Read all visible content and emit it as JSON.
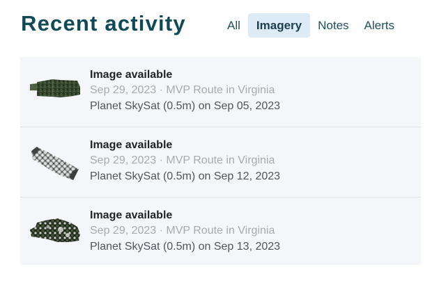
{
  "header": {
    "title": "Recent activity",
    "tabs": [
      {
        "label": "All",
        "active": false
      },
      {
        "label": "Imagery",
        "active": true
      },
      {
        "label": "Notes",
        "active": false
      },
      {
        "label": "Alerts",
        "active": false
      }
    ]
  },
  "activity": {
    "items": [
      {
        "title": "Image available",
        "meta": "Sep 29, 2023 · MVP Route in Virginia",
        "detail": "Planet SkySat (0.5m) on Sep 05, 2023",
        "thumbnail_icon": "satellite-image-strip-icon"
      },
      {
        "title": "Image available",
        "meta": "Sep 29, 2023 · MVP Route in Virginia",
        "detail": "Planet SkySat (0.5m) on Sep 12, 2023",
        "thumbnail_icon": "satellite-image-strip-icon"
      },
      {
        "title": "Image available",
        "meta": "Sep 29, 2023 · MVP Route in Virginia",
        "detail": "Planet SkySat (0.5m) on Sep 13, 2023",
        "thumbnail_icon": "satellite-image-strip-icon"
      }
    ]
  }
}
